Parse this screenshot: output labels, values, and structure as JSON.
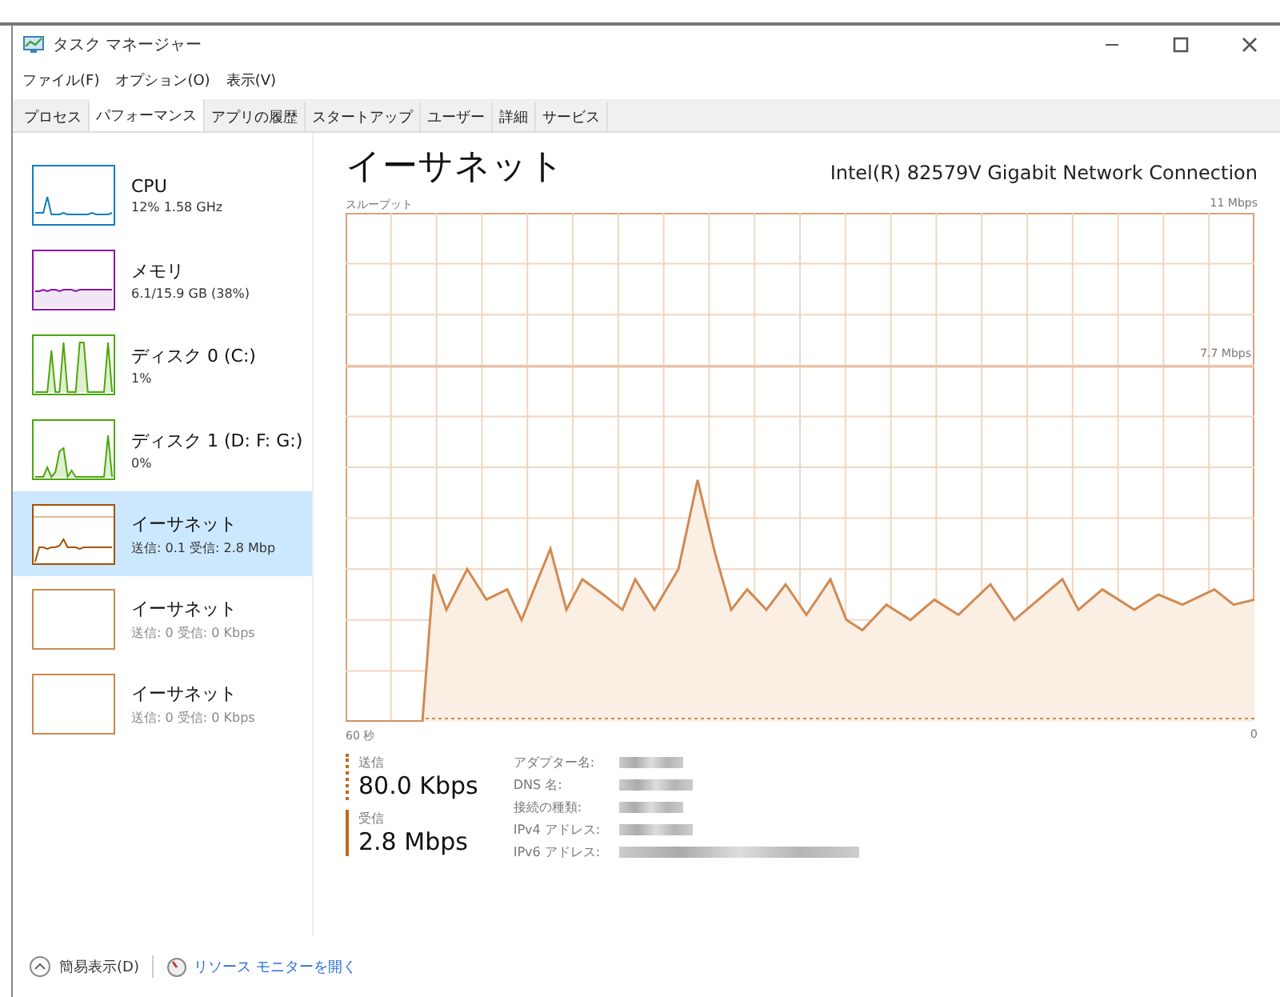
{
  "window": {
    "title": "タスク マネージャー"
  },
  "menu": [
    "ファイル(F)",
    "オプション(O)",
    "表示(V)"
  ],
  "tabs": [
    {
      "label": "プロセス",
      "selected": false
    },
    {
      "label": "パフォーマンス",
      "selected": true
    },
    {
      "label": "アプリの履歴",
      "selected": false
    },
    {
      "label": "スタートアップ",
      "selected": false
    },
    {
      "label": "ユーザー",
      "selected": false
    },
    {
      "label": "詳細",
      "selected": false
    },
    {
      "label": "サービス",
      "selected": false
    }
  ],
  "sidebar": {
    "items": [
      {
        "kind": "cpu",
        "name": "CPU",
        "detail": "12% 1.58 GHz",
        "selected": false
      },
      {
        "kind": "memory",
        "name": "メモリ",
        "detail": "6.1/15.9 GB (38%)",
        "selected": false
      },
      {
        "kind": "disk",
        "name": "ディスク 0 (C:)",
        "detail": "1%",
        "selected": false
      },
      {
        "kind": "disk",
        "name": "ディスク 1 (D: F: G:)",
        "detail": "0%",
        "selected": false
      },
      {
        "kind": "ethernet",
        "name": "イーサネット",
        "detail": "送信: 0.1 受信: 2.8 Mbp",
        "selected": true
      },
      {
        "kind": "ethernet_idle",
        "name": "イーサネット",
        "detail": "送信: 0 受信: 0 Kbps",
        "selected": false
      },
      {
        "kind": "ethernet_idle",
        "name": "イーサネット",
        "detail": "送信: 0 受信: 0 Kbps",
        "selected": false
      }
    ]
  },
  "main": {
    "title": "イーサネット",
    "device": "Intel(R) 82579V Gigabit Network Connection",
    "chart_label": "スループット",
    "max_label": "11 Mbps",
    "mid_label": "7.7 Mbps",
    "time_start": "60 秒",
    "time_end": "0",
    "send": {
      "label": "送信",
      "value": "80.0 Kbps"
    },
    "receive": {
      "label": "受信",
      "value": "2.8 Mbps"
    },
    "properties": [
      "アダプター名:",
      "DNS 名:",
      "接続の種類:",
      "IPv4 アドレス:",
      "IPv6 アドレス:"
    ]
  },
  "footer": {
    "summary": "簡易表示(D)",
    "link": "リソース モニターを開く"
  }
}
